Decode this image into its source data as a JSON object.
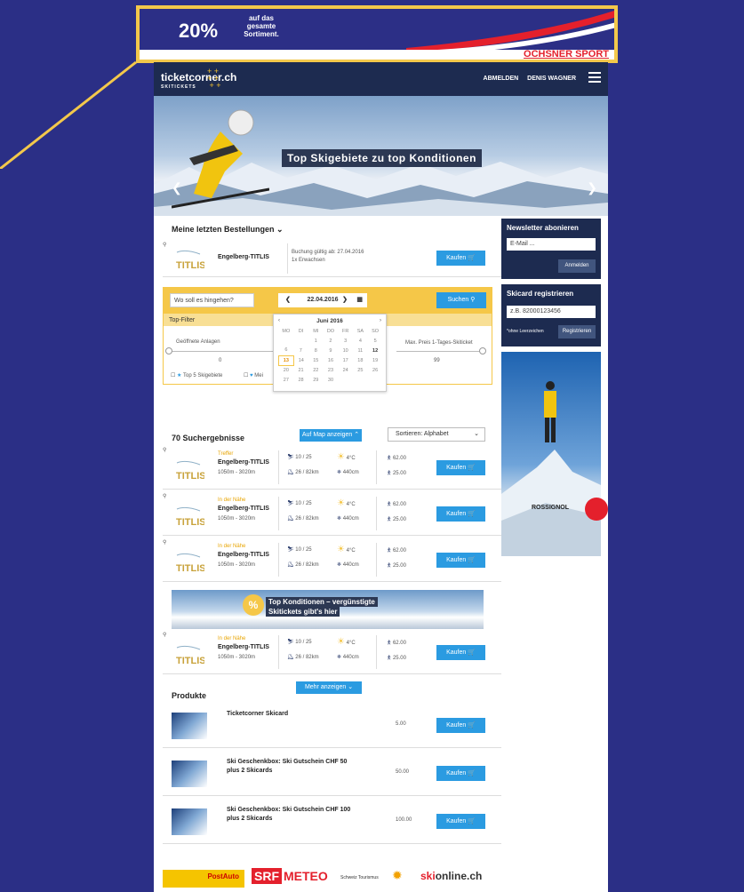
{
  "ad": {
    "percent": "20%",
    "text": "auf das gesamte Sortiment.",
    "brand": "OCHSNER SPORT"
  },
  "header": {
    "logo": "ticketcorner.ch",
    "logo_sub": "SKITICKETS",
    "logout": "ABMELDEN",
    "user": "DENIS WAGNER"
  },
  "hero": {
    "title": "Top Skigebiete zu top Konditionen"
  },
  "orders": {
    "title": "Meine letzten Bestellungen",
    "resort": "Engelberg-TITLIS",
    "booking": "Buchung gültig ab: 27.04.2016",
    "ticket": "1x Erwachsen",
    "buy": "Kaufen"
  },
  "search": {
    "placeholder": "Wo soll es hingehen?",
    "date": "22.04.2016",
    "submit": "Suchen"
  },
  "filter": {
    "title": "Top-Filter",
    "open_lifts": "Geöffnete Anlagen",
    "open_value": "0",
    "max_price": "Max. Preis 1-Tages-Skiticket",
    "max_value": "99",
    "top5": "Top 5 Skigebiete",
    "fav": "Mei"
  },
  "calendar": {
    "month": "Juni 2016",
    "days": [
      "MO",
      "DI",
      "MI",
      "DO",
      "FR",
      "SA",
      "SO"
    ],
    "weeks": [
      [
        "",
        "",
        "1",
        "2",
        "3",
        "4",
        "5"
      ],
      [
        "6",
        "7",
        "8",
        "9",
        "10",
        "11",
        "12"
      ],
      [
        "13",
        "14",
        "15",
        "16",
        "17",
        "18",
        "19"
      ],
      [
        "20",
        "21",
        "22",
        "23",
        "24",
        "25",
        "26"
      ],
      [
        "27",
        "28",
        "29",
        "30",
        "",
        "",
        ""
      ]
    ]
  },
  "results": {
    "count": "70 Suchergebnisse",
    "map": "Auf Map anzeigen",
    "sort": "Sortieren: Alphabet",
    "items": [
      {
        "tag": "Treffer",
        "name": "Engelberg-TITLIS",
        "alt": "1050m - 3020m",
        "lifts": "10 / 25",
        "slopes": "26 / 82km",
        "temp": "4°C",
        "snow": "440cm",
        "price1": "62.00",
        "price2": "25.00",
        "buy": "Kaufen"
      },
      {
        "tag": "In der Nähe",
        "name": "Engelberg-TITLIS",
        "alt": "1050m - 3020m",
        "lifts": "10 / 25",
        "slopes": "26 / 82km",
        "temp": "4°C",
        "snow": "440cm",
        "price1": "62.00",
        "price2": "25.00",
        "buy": "Kaufen"
      },
      {
        "tag": "In der Nähe",
        "name": "Engelberg-TITLIS",
        "alt": "1050m - 3020m",
        "lifts": "10 / 25",
        "slopes": "26 / 82km",
        "temp": "4°C",
        "snow": "440cm",
        "price1": "62.00",
        "price2": "25.00",
        "buy": "Kaufen"
      },
      {
        "tag": "In der Nähe",
        "name": "Engelberg-TITLIS",
        "alt": "1050m - 3020m",
        "lifts": "10 / 25",
        "slopes": "26 / 82km",
        "temp": "4°C",
        "snow": "440cm",
        "price1": "62.00",
        "price2": "25.00",
        "buy": "Kaufen"
      }
    ]
  },
  "promo": {
    "line1": "Top Konditionen – vergünstigte",
    "line2": "Skitickets gibt's hier"
  },
  "products": {
    "title": "Produkte",
    "more": "Mehr anzeigen",
    "items": [
      {
        "name": "Ticketcorner Skicard",
        "name2": "",
        "price": "5.00",
        "buy": "Kaufen"
      },
      {
        "name": "Ski Geschenkbox: Ski Gutschein CHF 50",
        "name2": "plus 2 Skicards",
        "price": "50.00",
        "buy": "Kaufen"
      },
      {
        "name": "Ski Geschenkbox: Ski Gutschein CHF 100",
        "name2": "plus 2 Skicards",
        "price": "100.00",
        "buy": "Kaufen"
      }
    ]
  },
  "sidebar": {
    "newsletter": "Newsletter abonieren",
    "email": "E-Mail ...",
    "subscribe": "Anmelden",
    "skicard": "Skicard registrieren",
    "card_no": "z.B. 82000123456",
    "note": "*ohne Leerzeichen",
    "register": "Registrieren",
    "ad_brand": "ROSSIGNOL"
  },
  "footer": {
    "postauto": "PostAuto",
    "srf1": "SRF",
    "srf2": "METEO",
    "st": "Schweiz Tourismus",
    "ski1": "ski",
    "ski2": "online.ch"
  }
}
